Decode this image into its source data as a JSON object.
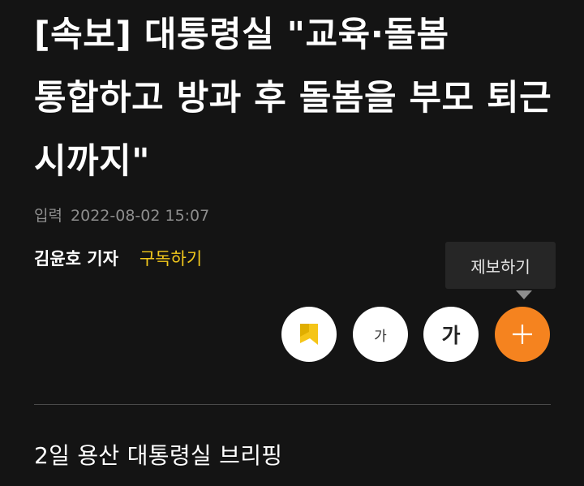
{
  "article": {
    "headline": "[속보] 대통령실 \"교육·돌봄 통합하고 방과 후 돌봄을 부모 퇴근 시까지\"",
    "date_label": "입력",
    "date_value": "2022-08-02 15:07",
    "reporter": "김윤호 기자",
    "subscribe_label": "구독하기",
    "subhead": "2일 용산 대통령실 브리핑"
  },
  "toolbar": {
    "tooltip": "제보하기",
    "font_small_label": "가",
    "font_large_label": "가",
    "icons": {
      "bookmark": "bookmark-icon",
      "report": "plus-icon"
    },
    "colors": {
      "bookmark": "#f5c518",
      "report_bg": "#f5831f",
      "subscribe": "#f2c81c"
    }
  }
}
